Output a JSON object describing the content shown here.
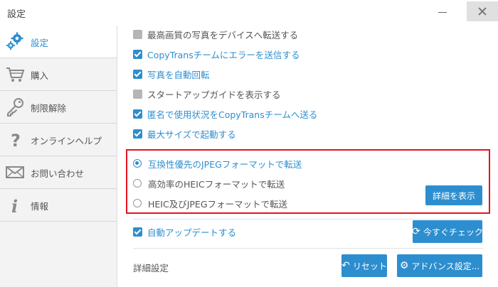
{
  "window": {
    "title": "設定"
  },
  "sidebar": {
    "items": [
      {
        "label": "設定",
        "icon": "gears-icon",
        "active": true
      },
      {
        "label": "購入",
        "icon": "cart-icon",
        "active": false
      },
      {
        "label": "制限解除",
        "icon": "key-icon",
        "active": false
      },
      {
        "label": "オンラインヘルプ",
        "icon": "question-icon",
        "active": false
      },
      {
        "label": "お問い合わせ",
        "icon": "envelope-icon",
        "active": false
      },
      {
        "label": "情報",
        "icon": "info-icon",
        "active": false
      }
    ]
  },
  "settings": {
    "options": [
      {
        "label": "最高画質の写真をデバイスへ転送する",
        "checked": false
      },
      {
        "label": "CopyTransチームにエラーを送信する",
        "checked": true
      },
      {
        "label": "写真を自動回転",
        "checked": true
      },
      {
        "label": "スタートアップガイドを表示する",
        "checked": false
      },
      {
        "label": "匿名で使用状況をCopyTransチームへ送る",
        "checked": true
      },
      {
        "label": "最大サイズで起動する",
        "checked": true
      }
    ],
    "format": {
      "radios": [
        {
          "label": "互換性優先のJPEGフォーマットで転送",
          "selected": true
        },
        {
          "label": "高効率のHEICフォーマットで転送",
          "selected": false
        },
        {
          "label": "HEIC及びJPEGフォーマットで転送",
          "selected": false
        }
      ],
      "details_button": "詳細を表示"
    },
    "auto_update": {
      "label": "自動アップデートする",
      "checked": true
    },
    "check_now_button": "今すぐチェック",
    "advanced": {
      "label": "詳細設定",
      "reset_button": "リセット",
      "advanced_button": "アドバンス設定..."
    }
  },
  "colors": {
    "accent": "#2d8ecf",
    "highlight": "#e3141f",
    "sidebar_bg": "#f3f3f3"
  }
}
